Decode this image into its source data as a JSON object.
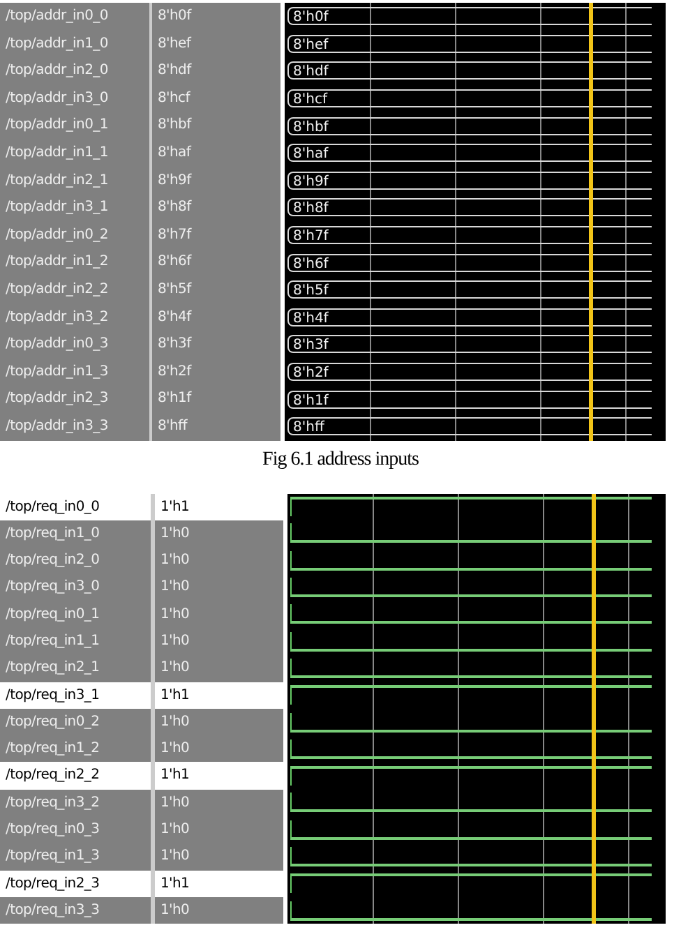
{
  "figures": [
    {
      "kind": "bus",
      "caption": "Fig 6.1 address inputs",
      "signals": [
        {
          "name": "/top/addr_in0_0",
          "value": "8'h0f",
          "selected": false,
          "wave_label": "8'h0f"
        },
        {
          "name": "/top/addr_in1_0",
          "value": "8'hef",
          "selected": false,
          "wave_label": "8'hef"
        },
        {
          "name": "/top/addr_in2_0",
          "value": "8'hdf",
          "selected": false,
          "wave_label": "8'hdf"
        },
        {
          "name": "/top/addr_in3_0",
          "value": "8'hcf",
          "selected": false,
          "wave_label": "8'hcf"
        },
        {
          "name": "/top/addr_in0_1",
          "value": "8'hbf",
          "selected": false,
          "wave_label": "8'hbf"
        },
        {
          "name": "/top/addr_in1_1",
          "value": "8'haf",
          "selected": false,
          "wave_label": "8'haf"
        },
        {
          "name": "/top/addr_in2_1",
          "value": "8'h9f",
          "selected": false,
          "wave_label": "8'h9f"
        },
        {
          "name": "/top/addr_in3_1",
          "value": "8'h8f",
          "selected": false,
          "wave_label": "8'h8f"
        },
        {
          "name": "/top/addr_in0_2",
          "value": "8'h7f",
          "selected": false,
          "wave_label": "8'h7f"
        },
        {
          "name": "/top/addr_in1_2",
          "value": "8'h6f",
          "selected": false,
          "wave_label": "8'h6f"
        },
        {
          "name": "/top/addr_in2_2",
          "value": "8'h5f",
          "selected": false,
          "wave_label": "8'h5f"
        },
        {
          "name": "/top/addr_in3_2",
          "value": "8'h4f",
          "selected": false,
          "wave_label": "8'h4f"
        },
        {
          "name": "/top/addr_in0_3",
          "value": "8'h3f",
          "selected": false,
          "wave_label": "8'h3f"
        },
        {
          "name": "/top/addr_in1_3",
          "value": "8'h2f",
          "selected": false,
          "wave_label": "8'h2f"
        },
        {
          "name": "/top/addr_in2_3",
          "value": "8'h1f",
          "selected": false,
          "wave_label": "8'h1f"
        },
        {
          "name": "/top/addr_in3_3",
          "value": "8'hff",
          "selected": false,
          "wave_label": "8'hff"
        }
      ]
    },
    {
      "kind": "bit",
      "signals": [
        {
          "name": "/top/req_in0_0",
          "value": "1'h1",
          "selected": true,
          "high": true
        },
        {
          "name": "/top/req_in1_0",
          "value": "1'h0",
          "selected": false,
          "high": false
        },
        {
          "name": "/top/req_in2_0",
          "value": "1'h0",
          "selected": false,
          "high": false
        },
        {
          "name": "/top/req_in3_0",
          "value": "1'h0",
          "selected": false,
          "high": false
        },
        {
          "name": "/top/req_in0_1",
          "value": "1'h0",
          "selected": false,
          "high": false
        },
        {
          "name": "/top/req_in1_1",
          "value": "1'h0",
          "selected": false,
          "high": false
        },
        {
          "name": "/top/req_in2_1",
          "value": "1'h0",
          "selected": false,
          "high": false
        },
        {
          "name": "/top/req_in3_1",
          "value": "1'h1",
          "selected": true,
          "high": true
        },
        {
          "name": "/top/req_in0_2",
          "value": "1'h0",
          "selected": false,
          "high": false
        },
        {
          "name": "/top/req_in1_2",
          "value": "1'h0",
          "selected": false,
          "high": false
        },
        {
          "name": "/top/req_in2_2",
          "value": "1'h1",
          "selected": true,
          "high": true
        },
        {
          "name": "/top/req_in3_2",
          "value": "1'h0",
          "selected": false,
          "high": false
        },
        {
          "name": "/top/req_in0_3",
          "value": "1'h0",
          "selected": false,
          "high": false
        },
        {
          "name": "/top/req_in1_3",
          "value": "1'h0",
          "selected": false,
          "high": false
        },
        {
          "name": "/top/req_in2_3",
          "value": "1'h1",
          "selected": true,
          "high": true
        },
        {
          "name": "/top/req_in3_3",
          "value": "1'h0",
          "selected": false,
          "high": false
        }
      ]
    }
  ]
}
